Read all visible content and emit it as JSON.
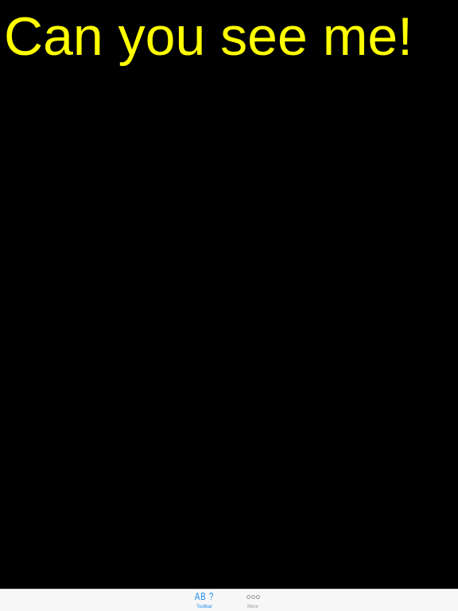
{
  "main": {
    "message": "Can you see me!"
  },
  "tabbar": {
    "tabs": [
      {
        "label": "Toolbar",
        "icon_text": "AB ?",
        "icon": "abc-text-icon",
        "selected": true
      },
      {
        "label": "More",
        "icon": "more-dots-icon",
        "selected": false
      }
    ]
  },
  "colors": {
    "background": "#000000",
    "message_text": "#ffff00",
    "tab_selected": "#1f8cf2",
    "tab_unselected": "#9a9a9a",
    "tabbar_background": "#f7f7f7"
  }
}
